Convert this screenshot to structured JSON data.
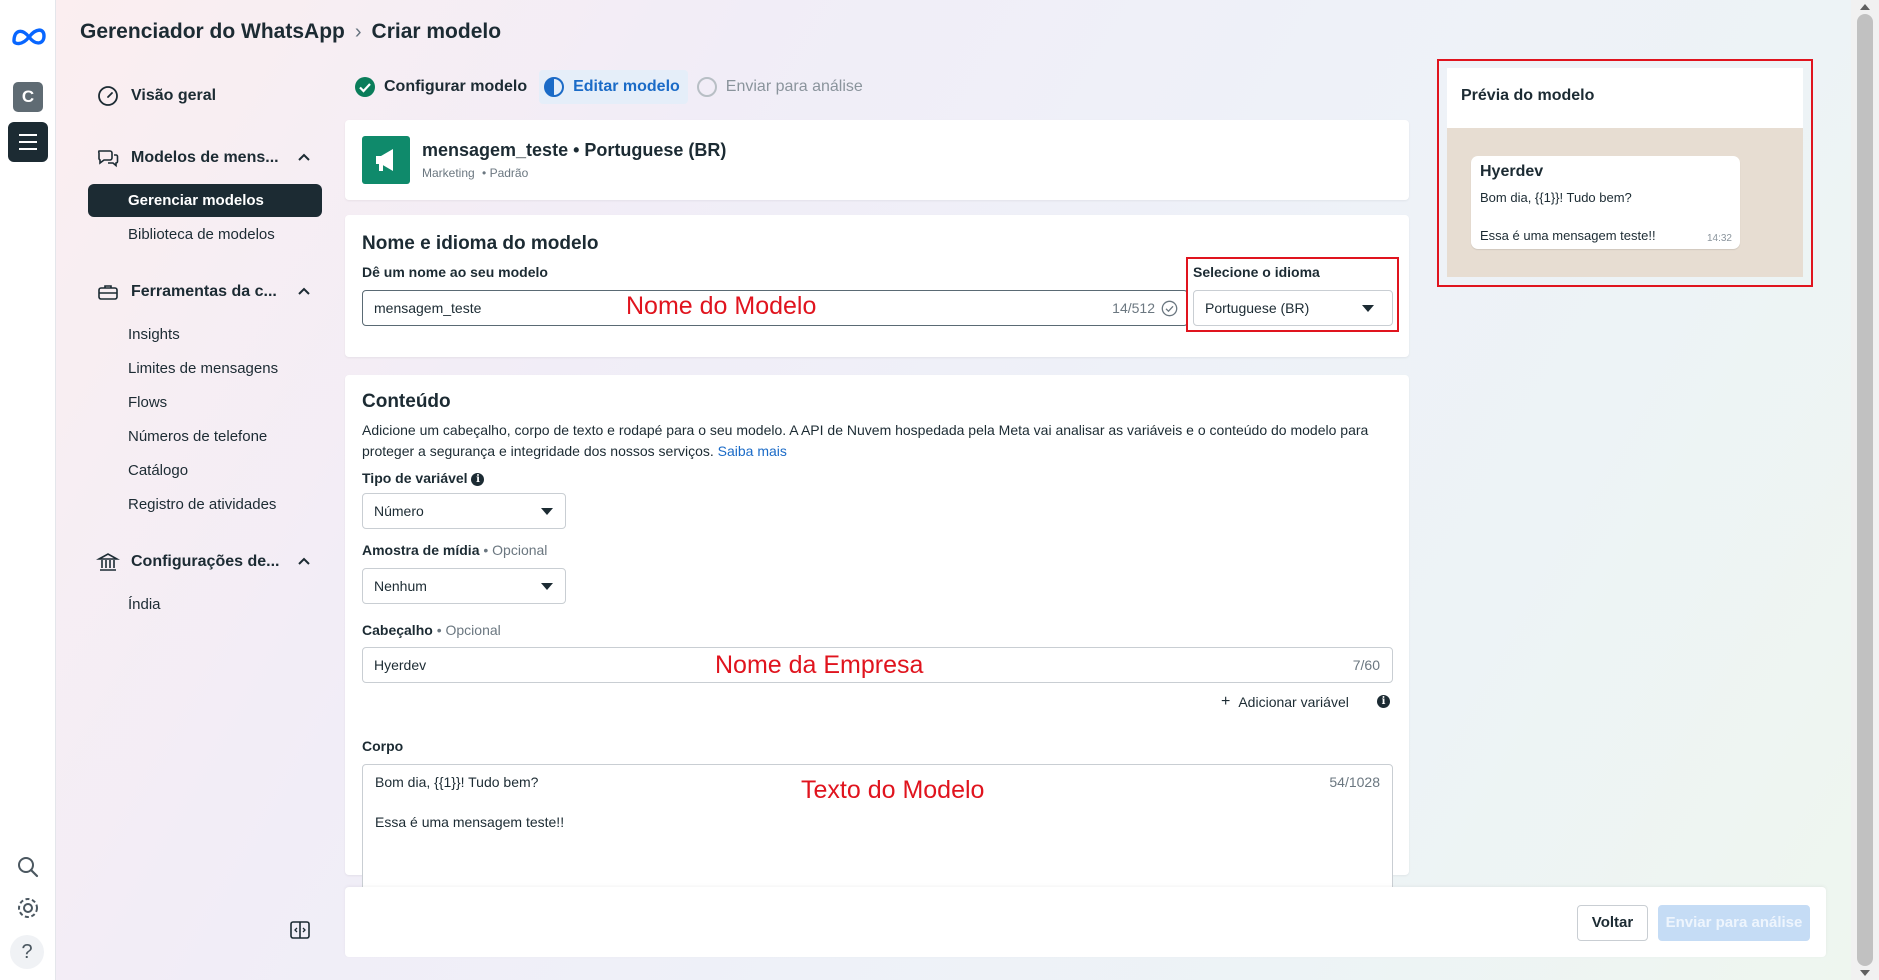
{
  "rail": {
    "avatar_letter": "C"
  },
  "breadcrumb": {
    "parent": "Gerenciador do WhatsApp",
    "current": "Criar modelo"
  },
  "sidebar": {
    "overview": "Visão geral",
    "templates_group": "Modelos de mens...",
    "manage_templates": "Gerenciar modelos",
    "template_library": "Biblioteca de modelos",
    "tools_group": "Ferramentas da c...",
    "tools": [
      "Insights",
      "Limites de mensagens",
      "Flows",
      "Números de telefone",
      "Catálogo",
      "Registro de atividades"
    ],
    "settings_group": "Configurações de...",
    "settings_item": "Índia"
  },
  "steps": [
    {
      "label": "Configurar modelo",
      "state": "done"
    },
    {
      "label": "Editar modelo",
      "state": "active"
    },
    {
      "label": "Enviar para análise",
      "state": "pending"
    }
  ],
  "template_header": {
    "name": "mensagem_teste • Portuguese (BR)",
    "category": "Marketing",
    "type": "• Padrão"
  },
  "name_lang": {
    "title": "Nome e idioma do modelo",
    "name_label": "Dê um nome ao seu modelo",
    "name_value": "mensagem_teste",
    "name_count": "14/512",
    "lang_label": "Selecione o idioma",
    "lang_value": "Portuguese (BR)"
  },
  "content": {
    "title": "Conteúdo",
    "description_line1": "Adicione um cabeçalho, corpo de texto e rodapé para o seu modelo. A API de Nuvem hospedada pela Meta vai analisar as variáveis e o conteúdo do modelo para",
    "description_line2": "proteger a segurança e integridade dos nossos serviços.",
    "learn_more": "Saiba mais",
    "var_type_label": "Tipo de variável",
    "var_type_value": "Número",
    "media_label": "Amostra de mídia",
    "media_optional": "• Opcional",
    "media_value": "Nenhum",
    "header_label": "Cabeçalho",
    "header_optional": "• Opcional",
    "header_value": "Hyerdev",
    "header_count": "7/60",
    "add_variable": "Adicionar variável",
    "body_label": "Corpo",
    "body_line1": "Bom dia, {{1}}! Tudo bem?",
    "body_line2": "Essa é uma mensagem teste!!",
    "body_count": "54/1028"
  },
  "annotations": {
    "name": "Nome do Modelo",
    "company": "Nome da Empresa",
    "text": "Texto do Modelo"
  },
  "footer": {
    "back": "Voltar",
    "submit": "Enviar para análise"
  },
  "preview": {
    "title": "Prévia do modelo",
    "header": "Hyerdev",
    "line1": "Bom dia, {{1}}! Tudo bem?",
    "line2": "Essa é uma mensagem teste!!",
    "time": "14:32"
  },
  "colors": {
    "accent": "#1b6bc7",
    "annotation_red": "#e0141e",
    "active_nav": "#1c2b33",
    "template_icon": "#0f8a6b"
  }
}
